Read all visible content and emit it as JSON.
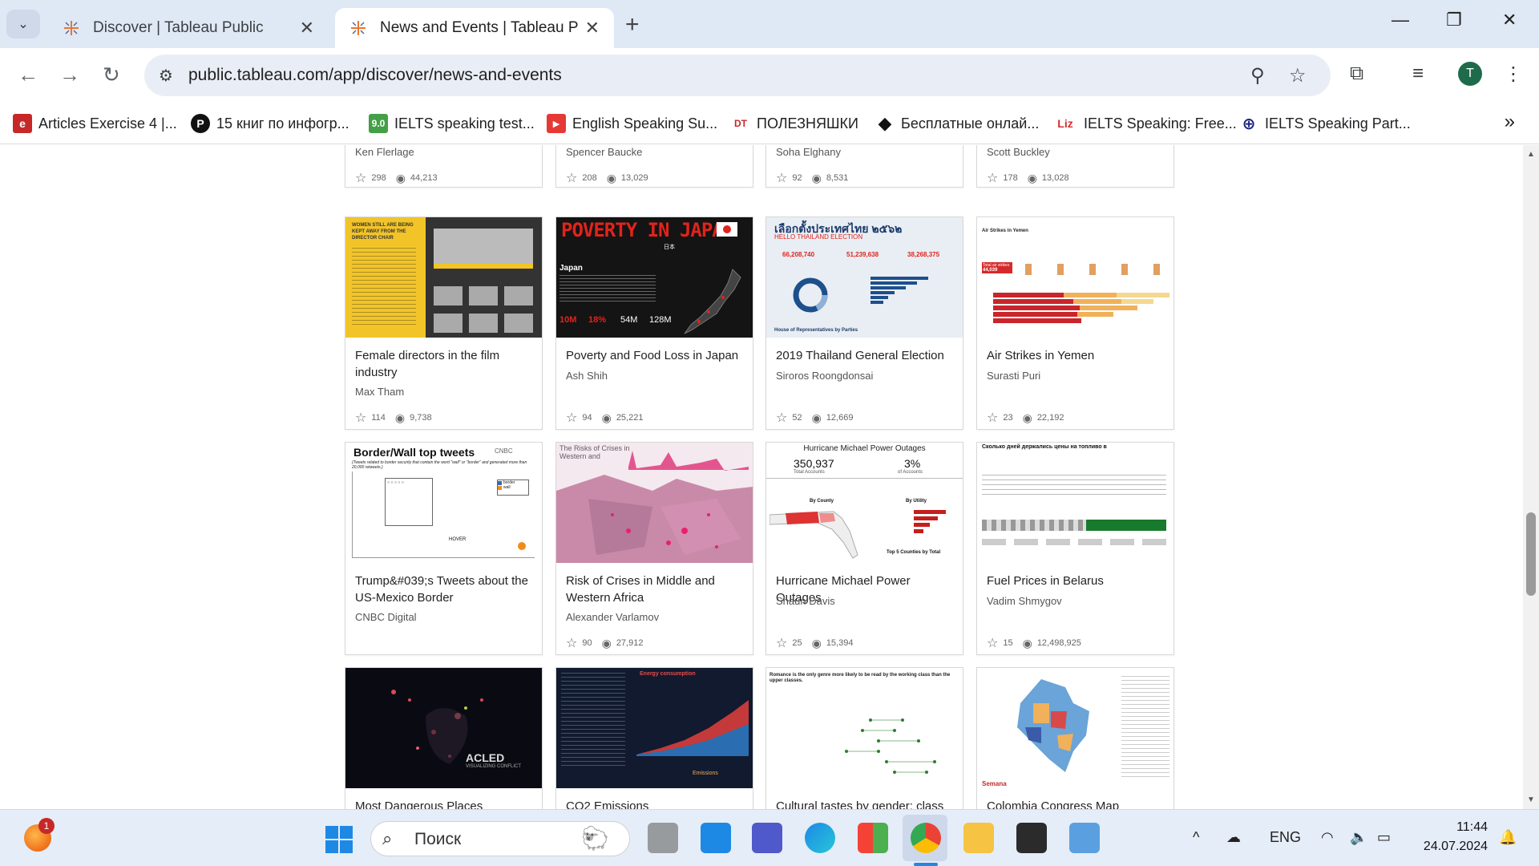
{
  "browser": {
    "tabs": [
      {
        "title": "Discover | Tableau Public",
        "active": false
      },
      {
        "title": "News and Events | Tableau Public",
        "active": true
      }
    ],
    "url": "public.tableau.com/app/discover/news-and-events",
    "profile_initial": "T"
  },
  "bookmarks": [
    {
      "label": "Articles Exercise 4 |...",
      "icon": "e",
      "color": "#c62828"
    },
    {
      "label": "15 книг по инфогр...",
      "icon": "P",
      "color": "#111111"
    },
    {
      "label": "IELTS speaking test...",
      "icon": "9.0",
      "color": "#43a047"
    },
    {
      "label": "English Speaking Su...",
      "icon": "▶",
      "color": "#e53935"
    },
    {
      "label": "ПОЛЕЗНЯШКИ",
      "icon": "DT",
      "color": "#ffffff"
    },
    {
      "label": "Бесплатные онлай...",
      "icon": "◆",
      "color": "#ffffff"
    },
    {
      "label": "IELTS Speaking: Free...",
      "icon": "Liz",
      "color": "#ffffff"
    },
    {
      "label": "IELTS Speaking Part...",
      "icon": "⊕",
      "color": "#ffffff"
    }
  ],
  "row0": [
    {
      "author": "Ken Flerlage",
      "favorites": "298",
      "views": "44,213"
    },
    {
      "author": "Spencer Baucke",
      "favorites": "208",
      "views": "13,029"
    },
    {
      "author": "Soha Elghany",
      "favorites": "92",
      "views": "8,531"
    },
    {
      "author": "Scott Buckley",
      "favorites": "178",
      "views": "13,028"
    }
  ],
  "row1": [
    {
      "title": "Female directors in the film industry",
      "author": "Max Tham",
      "favorites": "114",
      "views": "9,738"
    },
    {
      "title": "Poverty and Food Loss in Japan",
      "author": "Ash Shih",
      "favorites": "94",
      "views": "25,221"
    },
    {
      "title": "2019 Thailand General Election",
      "author": "Siroros Roongdonsai",
      "favorites": "52",
      "views": "12,669"
    },
    {
      "title": "Air Strikes in Yemen",
      "author": "Surasti Puri",
      "favorites": "23",
      "views": "22,192"
    }
  ],
  "row2": [
    {
      "title": "Trump&#039;s Tweets about the US-Mexico Border",
      "author": "CNBC Digital",
      "favorites": "",
      "views": ""
    },
    {
      "title": "Risk of Crises in Middle and Western Africa",
      "author": "Alexander Varlamov",
      "favorites": "90",
      "views": "27,912"
    },
    {
      "title": "Hurricane Michael Power Outages",
      "author": "Shaun Davis",
      "favorites": "25",
      "views": "15,394"
    },
    {
      "title": "Fuel Prices in Belarus",
      "author": "Vadim Shmygov",
      "favorites": "15",
      "views": "12,498,925"
    }
  ],
  "row3": [
    {
      "title": "Most Dangerous Places"
    },
    {
      "title": "CO2 Emissions"
    },
    {
      "title": "Cultural tastes by gender: class"
    },
    {
      "title": "Colombia Congress Map"
    }
  ],
  "thumbs": {
    "female": {
      "heading": "WOMEN STILL ARE BEING KEPT AWAY FROM THE DIRECTOR CHAIR"
    },
    "poverty": {
      "heading": "POVERTY IN JAPAN",
      "sub": "日本",
      "label": "Japan",
      "stats": [
        "10M",
        "18%",
        "54M",
        "128M"
      ]
    },
    "thailand": {
      "heading": "เลือกตั้งประเทศไทย ๒๕๖๒",
      "sub": "HELLO THAILAND ELECTION",
      "n1": "66,208,740",
      "n2": "51,239,638",
      "n3": "38,268,375",
      "footer": "House of Representatives by Parties"
    },
    "yemen": {
      "heading": "Air Strikes in Yemen",
      "total": "44,039",
      "total_label": "Total air strikes"
    },
    "border": {
      "heading": "Border/Wall top tweets",
      "sub": "(Tweets related to border security that contain the word \"wall\" or \"border\" and generated more than 20,000 retweets.)",
      "brand": "CNBC",
      "legend1": "border",
      "legend2": "wall",
      "hover": "HOVER"
    },
    "crisis": {
      "heading": "The Risks of Crises in Western and"
    },
    "hurricane": {
      "heading": "Hurricane Michael Power Outages",
      "n1": "350,937",
      "l1": "Total Accounts",
      "n2": "3%",
      "l2": "of Accounts",
      "county": "By County",
      "utility": "By Utility",
      "top5": "Top 5 Counties by Total"
    },
    "belarus": {
      "heading": "Сколько дней держались цены на топливо в"
    },
    "acled": {
      "heading": "ACLED",
      "sub": "VISUALIZING CONFLICT"
    },
    "co2": {
      "heading": "Energy consumption",
      "footer": "Emissions"
    },
    "romance": {
      "heading": "Romance is the only genre more likely to be read by the working class than the upper classes."
    },
    "colombia": {
      "brand": "Semana"
    }
  },
  "taskbar": {
    "search_placeholder": "Поиск",
    "lang": "ENG",
    "time": "11:44",
    "date": "24.07.2024",
    "notif_count": "1"
  }
}
